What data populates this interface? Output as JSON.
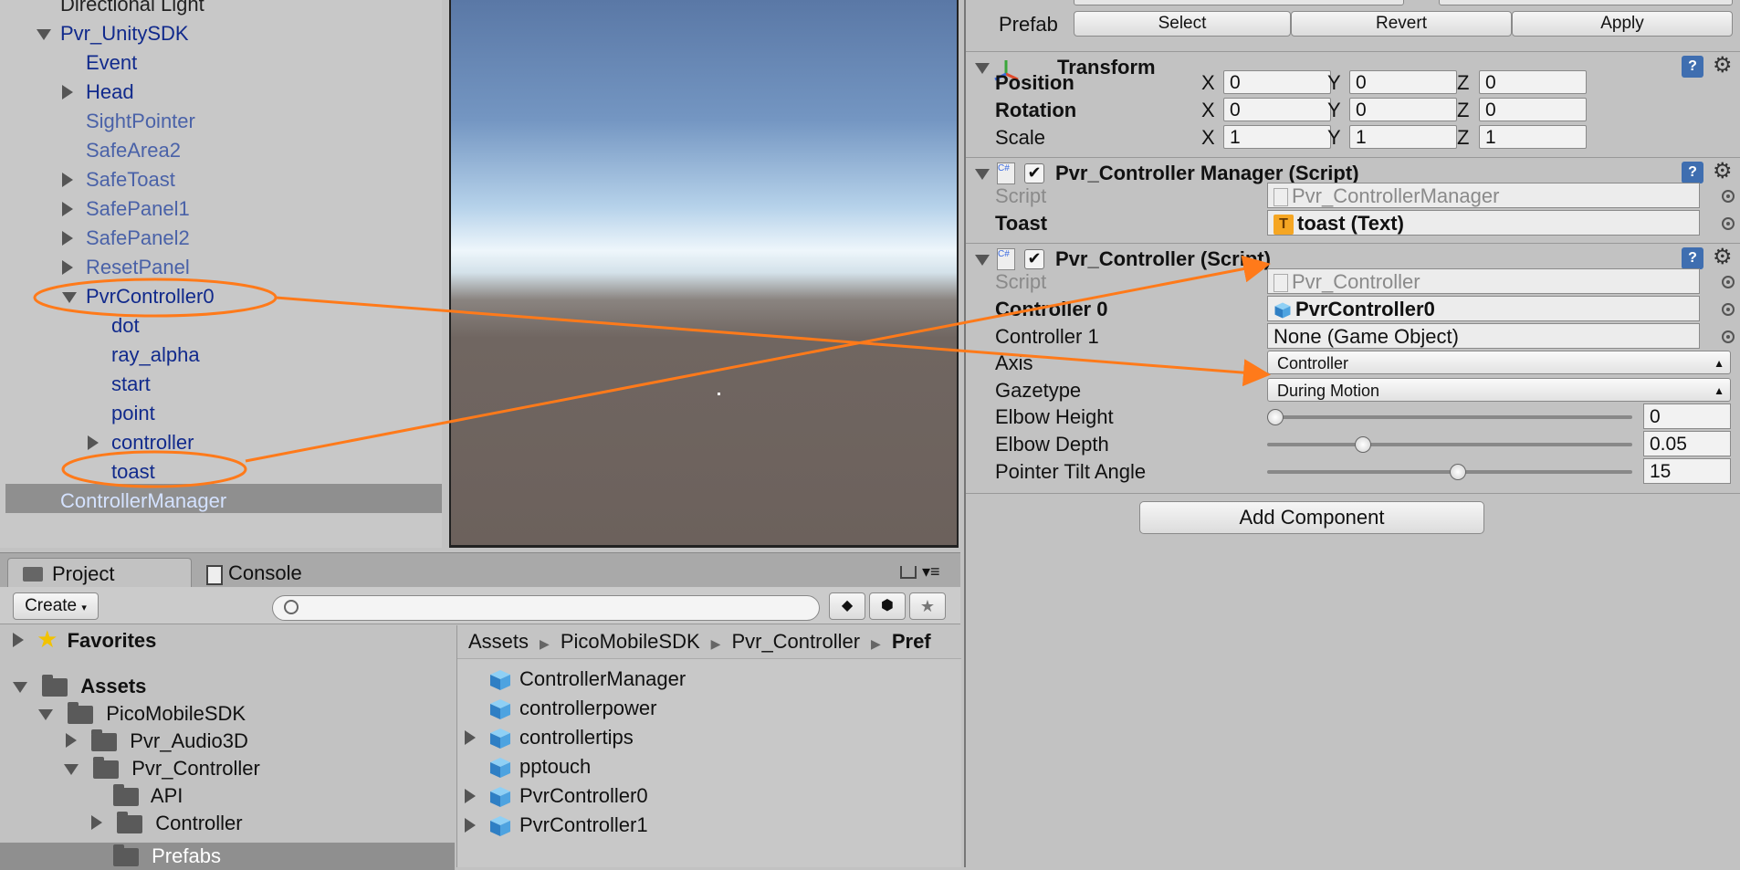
{
  "colors": {
    "annotation": "#ff7a1a",
    "hierarchy_text": "#112a8c",
    "prefab_dim": "#4a62a8"
  },
  "hierarchy": {
    "items": [
      {
        "label": "Directional Light",
        "expand": "none",
        "indent": 0
      },
      {
        "label": "Pvr_UnitySDK",
        "expand": "open",
        "indent": 0
      },
      {
        "label": "Event",
        "expand": "none",
        "indent": 1
      },
      {
        "label": "Head",
        "expand": "closed",
        "indent": 1
      },
      {
        "label": "SightPointer",
        "expand": "none",
        "indent": 1
      },
      {
        "label": "SafeArea2",
        "expand": "none",
        "indent": 1
      },
      {
        "label": "SafeToast",
        "expand": "closed",
        "indent": 1
      },
      {
        "label": "SafePanel1",
        "expand": "closed",
        "indent": 1
      },
      {
        "label": "SafePanel2",
        "expand": "closed",
        "indent": 1
      },
      {
        "label": "ResetPanel",
        "expand": "closed",
        "indent": 1
      },
      {
        "label": "PvrController0",
        "expand": "open",
        "indent": 1
      },
      {
        "label": "dot",
        "expand": "none",
        "indent": 2
      },
      {
        "label": "ray_alpha",
        "expand": "none",
        "indent": 2
      },
      {
        "label": "start",
        "expand": "none",
        "indent": 2
      },
      {
        "label": "point",
        "expand": "none",
        "indent": 2
      },
      {
        "label": "controller",
        "expand": "closed",
        "indent": 2
      },
      {
        "label": "toast",
        "expand": "none",
        "indent": 2
      },
      {
        "label": "ControllerManager",
        "expand": "none",
        "indent": 0,
        "selected": true
      }
    ]
  },
  "project": {
    "tabs": {
      "project": "Project",
      "console": "Console"
    },
    "create_label": "Create",
    "search_placeholder": "",
    "tree": {
      "favorites": "Favorites",
      "assets": "Assets",
      "pico": "PicoMobileSDK",
      "audio": "Pvr_Audio3D",
      "controller_folder": "Pvr_Controller",
      "api": "API",
      "controller": "Controller",
      "prefabs": "Prefabs"
    },
    "breadcrumb": [
      "Assets",
      "PicoMobileSDK",
      "Pvr_Controller",
      "Pref"
    ],
    "files": [
      "ControllerManager",
      "controllerpower",
      "controllertips",
      "pptouch",
      "PvrController0",
      "PvrController1"
    ]
  },
  "inspector": {
    "prefab": {
      "label": "Prefab",
      "select": "Select",
      "revert": "Revert",
      "apply": "Apply"
    },
    "transform": {
      "title": "Transform",
      "position_label": "Position",
      "rotation_label": "Rotation",
      "scale_label": "Scale",
      "axis_x": "X",
      "axis_y": "Y",
      "axis_z": "Z",
      "position": [
        "0",
        "0",
        "0"
      ],
      "rotation": [
        "0",
        "0",
        "0"
      ],
      "scale": [
        "1",
        "1",
        "1"
      ]
    },
    "manager": {
      "title": "Pvr_Controller Manager (Script)",
      "script_label": "Script",
      "script_value": "Pvr_ControllerManager",
      "toast_label": "Toast",
      "toast_value": "toast (Text)"
    },
    "controller": {
      "title": "Pvr_Controller (Script)",
      "script_label": "Script",
      "script_value": "Pvr_Controller",
      "c0_label": "Controller 0",
      "c0_value": "PvrController0",
      "c1_label": "Controller 1",
      "c1_value": "None (Game Object)",
      "axis_label": "Axis",
      "axis_value": "Controller",
      "gaze_label": "Gazetype",
      "gaze_value": "During Motion",
      "elbow_height_label": "Elbow Height",
      "elbow_height": "0",
      "elbow_depth_label": "Elbow Depth",
      "elbow_depth": "0.05",
      "tilt_label": "Pointer Tilt Angle",
      "tilt": "15",
      "elbow_height_level": 0.0,
      "elbow_depth_level": 0.24,
      "tilt_level": 0.5
    },
    "add_component": "Add Component"
  }
}
